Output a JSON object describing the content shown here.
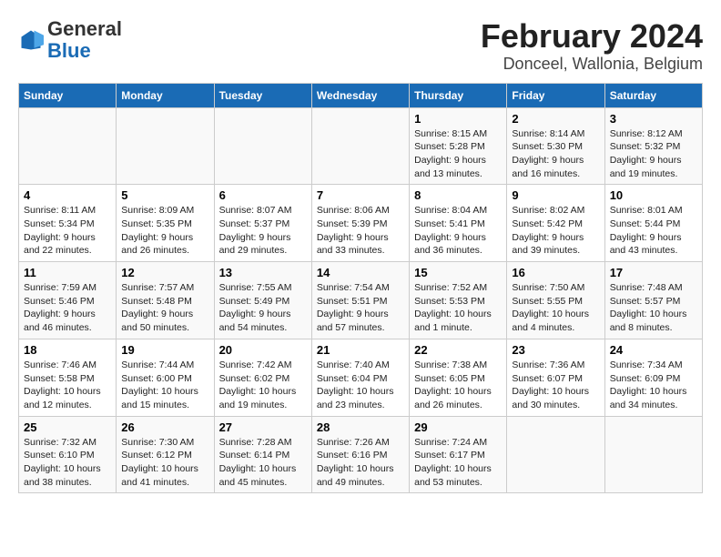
{
  "logo": {
    "general": "General",
    "blue": "Blue"
  },
  "title": "February 2024",
  "subtitle": "Donceel, Wallonia, Belgium",
  "days_of_week": [
    "Sunday",
    "Monday",
    "Tuesday",
    "Wednesday",
    "Thursday",
    "Friday",
    "Saturday"
  ],
  "weeks": [
    [
      {
        "day": "",
        "info": ""
      },
      {
        "day": "",
        "info": ""
      },
      {
        "day": "",
        "info": ""
      },
      {
        "day": "",
        "info": ""
      },
      {
        "day": "1",
        "info": "Sunrise: 8:15 AM\nSunset: 5:28 PM\nDaylight: 9 hours\nand 13 minutes."
      },
      {
        "day": "2",
        "info": "Sunrise: 8:14 AM\nSunset: 5:30 PM\nDaylight: 9 hours\nand 16 minutes."
      },
      {
        "day": "3",
        "info": "Sunrise: 8:12 AM\nSunset: 5:32 PM\nDaylight: 9 hours\nand 19 minutes."
      }
    ],
    [
      {
        "day": "4",
        "info": "Sunrise: 8:11 AM\nSunset: 5:34 PM\nDaylight: 9 hours\nand 22 minutes."
      },
      {
        "day": "5",
        "info": "Sunrise: 8:09 AM\nSunset: 5:35 PM\nDaylight: 9 hours\nand 26 minutes."
      },
      {
        "day": "6",
        "info": "Sunrise: 8:07 AM\nSunset: 5:37 PM\nDaylight: 9 hours\nand 29 minutes."
      },
      {
        "day": "7",
        "info": "Sunrise: 8:06 AM\nSunset: 5:39 PM\nDaylight: 9 hours\nand 33 minutes."
      },
      {
        "day": "8",
        "info": "Sunrise: 8:04 AM\nSunset: 5:41 PM\nDaylight: 9 hours\nand 36 minutes."
      },
      {
        "day": "9",
        "info": "Sunrise: 8:02 AM\nSunset: 5:42 PM\nDaylight: 9 hours\nand 39 minutes."
      },
      {
        "day": "10",
        "info": "Sunrise: 8:01 AM\nSunset: 5:44 PM\nDaylight: 9 hours\nand 43 minutes."
      }
    ],
    [
      {
        "day": "11",
        "info": "Sunrise: 7:59 AM\nSunset: 5:46 PM\nDaylight: 9 hours\nand 46 minutes."
      },
      {
        "day": "12",
        "info": "Sunrise: 7:57 AM\nSunset: 5:48 PM\nDaylight: 9 hours\nand 50 minutes."
      },
      {
        "day": "13",
        "info": "Sunrise: 7:55 AM\nSunset: 5:49 PM\nDaylight: 9 hours\nand 54 minutes."
      },
      {
        "day": "14",
        "info": "Sunrise: 7:54 AM\nSunset: 5:51 PM\nDaylight: 9 hours\nand 57 minutes."
      },
      {
        "day": "15",
        "info": "Sunrise: 7:52 AM\nSunset: 5:53 PM\nDaylight: 10 hours\nand 1 minute."
      },
      {
        "day": "16",
        "info": "Sunrise: 7:50 AM\nSunset: 5:55 PM\nDaylight: 10 hours\nand 4 minutes."
      },
      {
        "day": "17",
        "info": "Sunrise: 7:48 AM\nSunset: 5:57 PM\nDaylight: 10 hours\nand 8 minutes."
      }
    ],
    [
      {
        "day": "18",
        "info": "Sunrise: 7:46 AM\nSunset: 5:58 PM\nDaylight: 10 hours\nand 12 minutes."
      },
      {
        "day": "19",
        "info": "Sunrise: 7:44 AM\nSunset: 6:00 PM\nDaylight: 10 hours\nand 15 minutes."
      },
      {
        "day": "20",
        "info": "Sunrise: 7:42 AM\nSunset: 6:02 PM\nDaylight: 10 hours\nand 19 minutes."
      },
      {
        "day": "21",
        "info": "Sunrise: 7:40 AM\nSunset: 6:04 PM\nDaylight: 10 hours\nand 23 minutes."
      },
      {
        "day": "22",
        "info": "Sunrise: 7:38 AM\nSunset: 6:05 PM\nDaylight: 10 hours\nand 26 minutes."
      },
      {
        "day": "23",
        "info": "Sunrise: 7:36 AM\nSunset: 6:07 PM\nDaylight: 10 hours\nand 30 minutes."
      },
      {
        "day": "24",
        "info": "Sunrise: 7:34 AM\nSunset: 6:09 PM\nDaylight: 10 hours\nand 34 minutes."
      }
    ],
    [
      {
        "day": "25",
        "info": "Sunrise: 7:32 AM\nSunset: 6:10 PM\nDaylight: 10 hours\nand 38 minutes."
      },
      {
        "day": "26",
        "info": "Sunrise: 7:30 AM\nSunset: 6:12 PM\nDaylight: 10 hours\nand 41 minutes."
      },
      {
        "day": "27",
        "info": "Sunrise: 7:28 AM\nSunset: 6:14 PM\nDaylight: 10 hours\nand 45 minutes."
      },
      {
        "day": "28",
        "info": "Sunrise: 7:26 AM\nSunset: 6:16 PM\nDaylight: 10 hours\nand 49 minutes."
      },
      {
        "day": "29",
        "info": "Sunrise: 7:24 AM\nSunset: 6:17 PM\nDaylight: 10 hours\nand 53 minutes."
      },
      {
        "day": "",
        "info": ""
      },
      {
        "day": "",
        "info": ""
      }
    ]
  ]
}
